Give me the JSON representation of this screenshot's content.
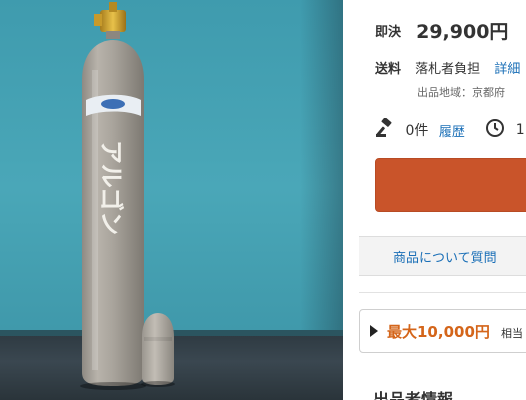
{
  "photo": {
    "cylinder_text": "アルゴン"
  },
  "price": {
    "label": "即決",
    "value": "29,900円"
  },
  "shipping": {
    "label": "送料",
    "value": "落札者負担",
    "link": "詳細"
  },
  "region": {
    "text": "出品地域：京都府"
  },
  "bids": {
    "count": "0件",
    "history_link": "履歴",
    "time_prefix": "1"
  },
  "question": {
    "link": "商品について質問"
  },
  "promo": {
    "headline": "最大10,000円",
    "sub": "相当"
  },
  "next_section": {
    "title": "出品者情報"
  },
  "icons": {
    "bid": "gavel-icon",
    "time": "clock-icon",
    "promo": "caret-right-icon"
  },
  "colors": {
    "bid_button": "#c9542a",
    "link": "#1a6fb7",
    "promo_highlight": "#d4651a"
  }
}
